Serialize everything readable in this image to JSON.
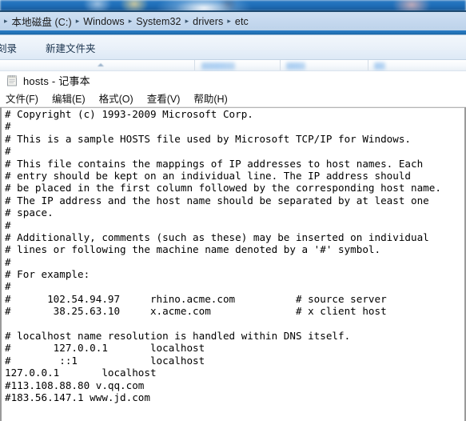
{
  "window": {
    "titlebar_note": "blurred-blue-window-titlebar"
  },
  "explorer": {
    "breadcrumb": {
      "name": "address-bar",
      "leading_separator": "▸",
      "items": [
        {
          "label": "本地磁盘 (C:)",
          "separator": "▸"
        },
        {
          "label": "Windows",
          "separator": "▸"
        },
        {
          "label": "System32",
          "separator": "▸"
        },
        {
          "label": "drivers",
          "separator": "▸"
        },
        {
          "label": "etc",
          "separator": ""
        }
      ]
    },
    "toolbar": {
      "items": [
        {
          "label": "刻录"
        },
        {
          "label": "新建文件夹"
        }
      ]
    },
    "column_header": {
      "sort_icon": "sort-ascending-arrow-icon",
      "headers_blurred": true
    }
  },
  "notepad": {
    "icon": "notepad-document-icon",
    "title": "hosts - 记事本",
    "menu": [
      {
        "label": "文件(F)"
      },
      {
        "label": "编辑(E)"
      },
      {
        "label": "格式(O)"
      },
      {
        "label": "查看(V)"
      },
      {
        "label": "帮助(H)"
      }
    ],
    "content_lines": [
      "# Copyright (c) 1993-2009 Microsoft Corp.",
      "#",
      "# This is a sample HOSTS file used by Microsoft TCP/IP for Windows.",
      "#",
      "# This file contains the mappings of IP addresses to host names. Each",
      "# entry should be kept on an individual line. The IP address should",
      "# be placed in the first column followed by the corresponding host name.",
      "# The IP address and the host name should be separated by at least one",
      "# space.",
      "#",
      "# Additionally, comments (such as these) may be inserted on individual",
      "# lines or following the machine name denoted by a '#' symbol.",
      "#",
      "# For example:",
      "#",
      "#      102.54.94.97     rhino.acme.com          # source server",
      "#       38.25.63.10     x.acme.com              # x client host",
      "",
      "# localhost name resolution is handled within DNS itself.",
      "#       127.0.0.1       localhost",
      "#        ::1            localhost",
      "127.0.0.1       localhost",
      "#113.108.88.80 v.qq.com",
      "#183.56.147.1 www.jd.com"
    ]
  },
  "colors": {
    "addressbar_bg": "#c6d9ef",
    "addressbar_accent": "#2173b8",
    "toolbar_bg": "#eaf1f9",
    "notepad_bg": "#ffffff",
    "text": "#000000",
    "titlebar_blue": "#1f6fba"
  }
}
